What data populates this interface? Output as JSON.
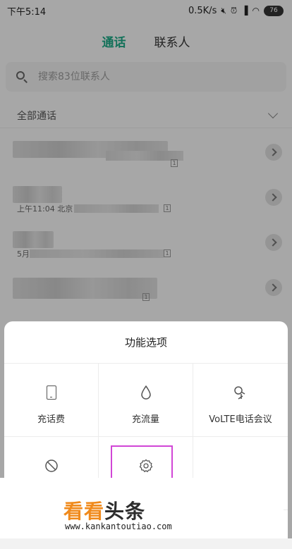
{
  "status_bar": {
    "time": "下午5:14",
    "network_speed": "0.5K/s",
    "battery": "76"
  },
  "tabs": [
    {
      "label": "通话",
      "active": true
    },
    {
      "label": "联系人",
      "active": false
    }
  ],
  "search": {
    "placeholder": "搜索83位联系人"
  },
  "filter": {
    "label": "全部通话"
  },
  "call_rows": [
    {
      "sub_text": ""
    },
    {
      "sub_text": "上午11:04 北京"
    },
    {
      "sub_text": "5月"
    },
    {
      "sub_text": ""
    }
  ],
  "options_sheet": {
    "title": "功能选项",
    "items": [
      {
        "label": "充话费",
        "icon": "phone-icon"
      },
      {
        "label": "充流量",
        "icon": "droplet-icon"
      },
      {
        "label": "VoLTE电话会议",
        "icon": "conference-call-icon"
      },
      {
        "label": "",
        "icon": "block-icon"
      },
      {
        "label": "",
        "icon": "settings-gear-icon"
      },
      {
        "label": "",
        "icon": ""
      }
    ]
  },
  "watermark": {
    "brand_part1": "看看",
    "brand_part2": "头条",
    "url": "www.kankantoutiao.com"
  },
  "colors": {
    "accent": "#1ba784",
    "highlight": "#d146d6",
    "brand_orange": "#f08a1c"
  }
}
